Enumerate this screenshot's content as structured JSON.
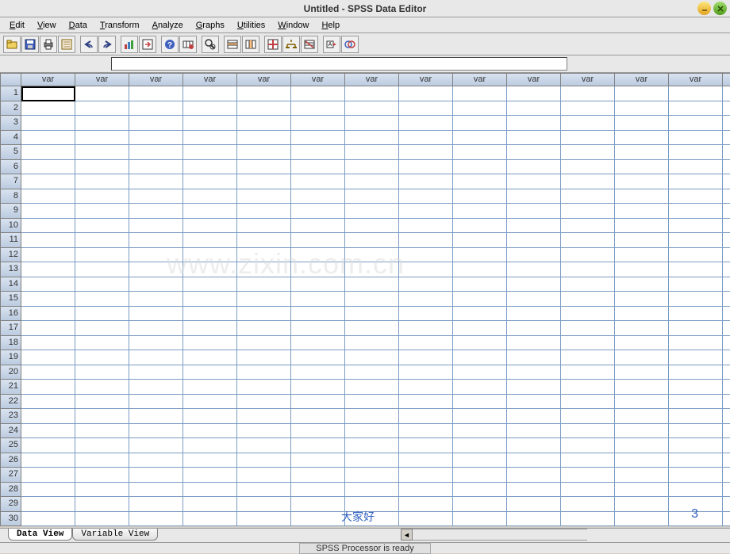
{
  "title": "Untitled - SPSS Data Editor",
  "menus": [
    "Edit",
    "View",
    "Data",
    "Transform",
    "Analyze",
    "Graphs",
    "Utilities",
    "Window",
    "Help"
  ],
  "toolbar_icons": [
    "open",
    "save",
    "print",
    "recent",
    "",
    "undo",
    "redo",
    "",
    "chart",
    "goto",
    "",
    "info",
    "variables",
    "",
    "find",
    "",
    "insert-case",
    "insert-variable",
    "",
    "split",
    "weight",
    "select",
    "",
    "value-labels",
    "sets"
  ],
  "column_header_label": "var",
  "num_columns": 13,
  "num_rows": 30,
  "active_cell": {
    "row": 1,
    "col": 1
  },
  "watermark": "www.zixin.com.cn",
  "annotations": {
    "center": "大家好",
    "right": "3"
  },
  "tabs": [
    {
      "label": "Data View",
      "active": true
    },
    {
      "label": "Variable View",
      "active": false
    }
  ],
  "status": "SPSS Processor  is ready"
}
